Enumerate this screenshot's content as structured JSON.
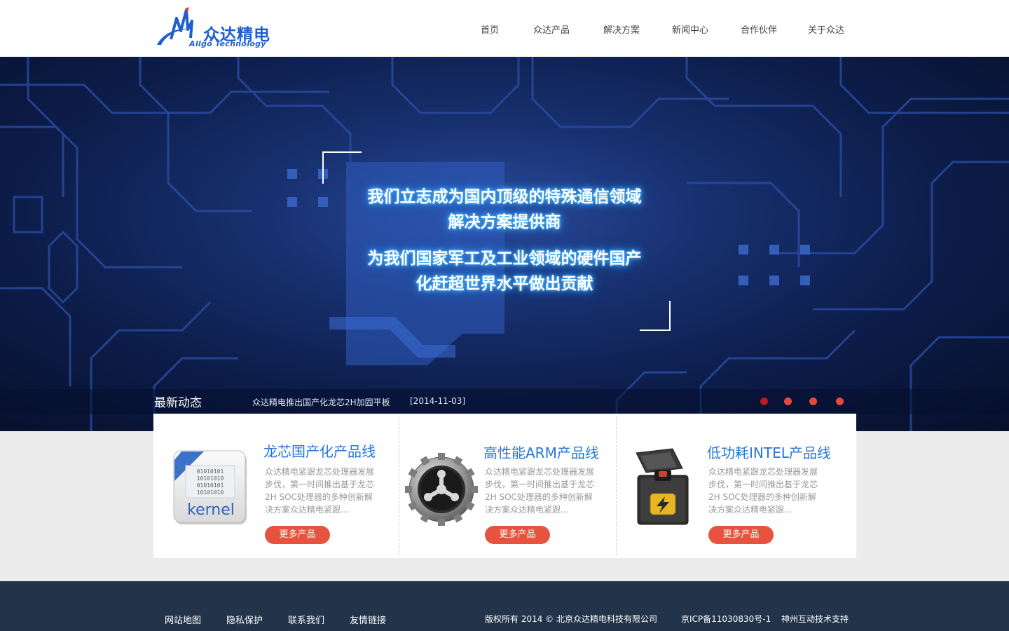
{
  "brand": {
    "name": "众达精电",
    "subtitle": "Allgo Technology",
    "color": "#1d5fd1"
  },
  "nav": {
    "items": [
      {
        "label": "首页"
      },
      {
        "label": "众达产品"
      },
      {
        "label": "解决方案"
      },
      {
        "label": "新闻中心"
      },
      {
        "label": "合作伙伴"
      },
      {
        "label": "关于众达"
      }
    ]
  },
  "banner": {
    "slogan1_line1": "我们立志成为国内顶级的特殊通信领域",
    "slogan1_line2": "解决方案提供商",
    "slogan2_line1": "为我们国家军工及工业领域的硬件国产",
    "slogan2_line2": "化赶超世界水平做出贡献",
    "slide_count": 4,
    "active_slide": 1
  },
  "news": {
    "title": "最新动态",
    "headline": "众达精电推出国产化龙芯2H加固平板",
    "date": "[2014-11-03]"
  },
  "products": [
    {
      "title": "龙芯国产化产品线",
      "icon": "kernel-icon",
      "desc": "众达精电紧跟龙芯处理器发展步伐，第一时间推出基于龙芯2H SOC处理器的多种创新解决方案众达精电紧跟...",
      "button": "更多产品",
      "icon_text": "kernel",
      "binary": [
        "01010101",
        "10101010",
        "01010101",
        "10101010"
      ]
    },
    {
      "title": "高性能ARM产品线",
      "icon": "gear-icon",
      "desc": "众达精电紧跟龙芯处理器发展步伐，第一时间推出基于龙芯2H SOC处理器的多种创新解决方案众达精电紧跟...",
      "button": "更多产品"
    },
    {
      "title": "低功耗INTEL产品线",
      "icon": "power-box-icon",
      "desc": "众达精电紧跟龙芯处理器发展步伐，第一时间推出基于龙芯2H SOC处理器的多种创新解决方案众达精电紧跟...",
      "button": "更多产品"
    }
  ],
  "footer": {
    "links": [
      "网站地图",
      "隐私保护",
      "联系我们",
      "友情链接"
    ],
    "copyright": "版权所有 2014 © 北京众达精电科技有限公司",
    "icp": "京ICP备11030830号-1",
    "support": "神州互动技术支持"
  },
  "colors": {
    "accent_button": "#e8533f",
    "product_title": "#2677d9",
    "footer_bg": "#22344a"
  }
}
